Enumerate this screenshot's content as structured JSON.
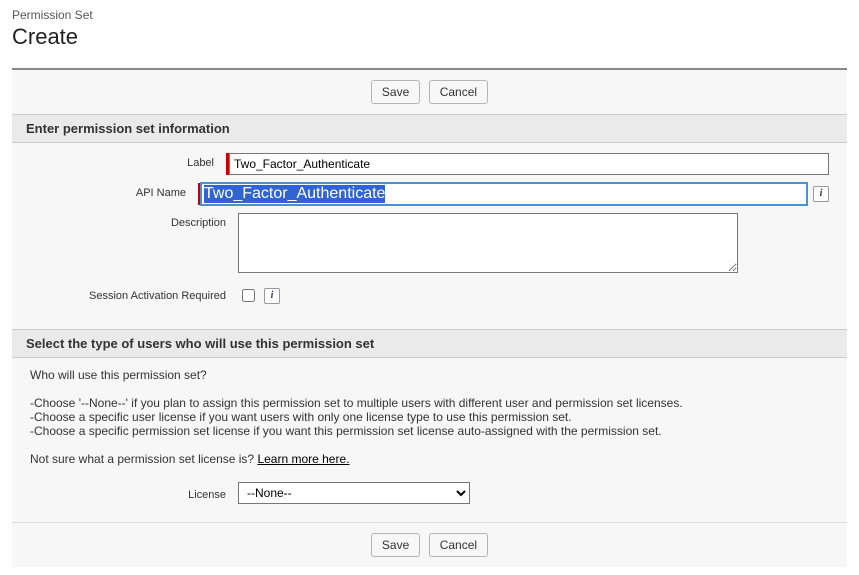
{
  "header": {
    "small": "Permission Set",
    "large": "Create"
  },
  "buttons": {
    "save": "Save",
    "cancel": "Cancel"
  },
  "section1": {
    "title": "Enter permission set information",
    "labels": {
      "label": "Label",
      "api": "API Name",
      "desc": "Description",
      "session": "Session Activation Required"
    },
    "values": {
      "label": "Two_Factor_Authenticate",
      "api": "Two_Factor_Authenticate",
      "desc": "",
      "session_checked": false
    }
  },
  "section2": {
    "title": "Select the type of users who will use this permission set",
    "intro": "Who will use this permission set?",
    "bullets": [
      "-Choose '--None--' if you plan to assign this permission set to multiple users with different user and permission set licenses.",
      "-Choose a specific user license if you want users with only one license type to use this permission set.",
      "-Choose a specific permission set license if you want this permission set license auto-assigned with the permission set."
    ],
    "not_sure_prefix": "Not sure what a permission set license is? ",
    "learn_more": "Learn more here.",
    "license_label": "License",
    "license_value": "--None--"
  }
}
